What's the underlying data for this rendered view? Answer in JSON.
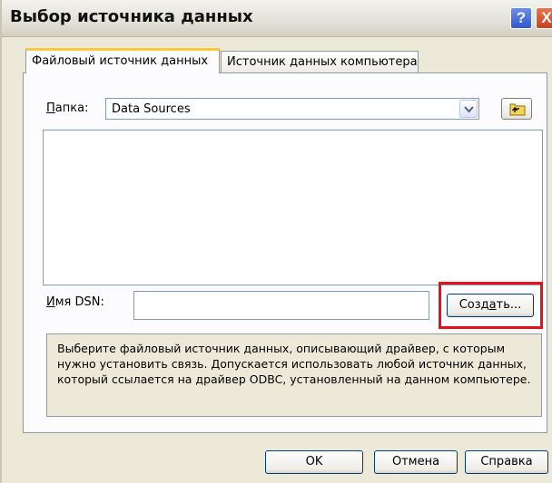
{
  "window": {
    "title": "Выбор источника данных",
    "help_glyph": "?",
    "close_glyph": "X"
  },
  "tabs": [
    {
      "label": "Файловый источник данных",
      "selected": true
    },
    {
      "label": "Источник данных компьютера",
      "selected": false
    }
  ],
  "folder": {
    "label_underlined": "П",
    "label_rest": "апка:",
    "value": "Data Sources",
    "up_icon": "folder-up-icon"
  },
  "dsn": {
    "label_underlined": "И",
    "label_rest": "мя DSN:",
    "value": ""
  },
  "create_button": {
    "label_pre": "Созд",
    "label_underlined": "а",
    "label_post": "ть..."
  },
  "info": "Выберите файловый источник данных, описывающий драйвер, с которым нужно установить связь.  Допускается использовать любой источник данных, который ссылается на драйвер ODBC, установленный на данном компьютере.",
  "buttons": {
    "ok": "OK",
    "cancel": "Отмена",
    "help": "Справка"
  },
  "colors": {
    "highlight": "#E8101A",
    "dialog_bg": "#ECE9D8",
    "tab_accent": "#FFC83C"
  }
}
